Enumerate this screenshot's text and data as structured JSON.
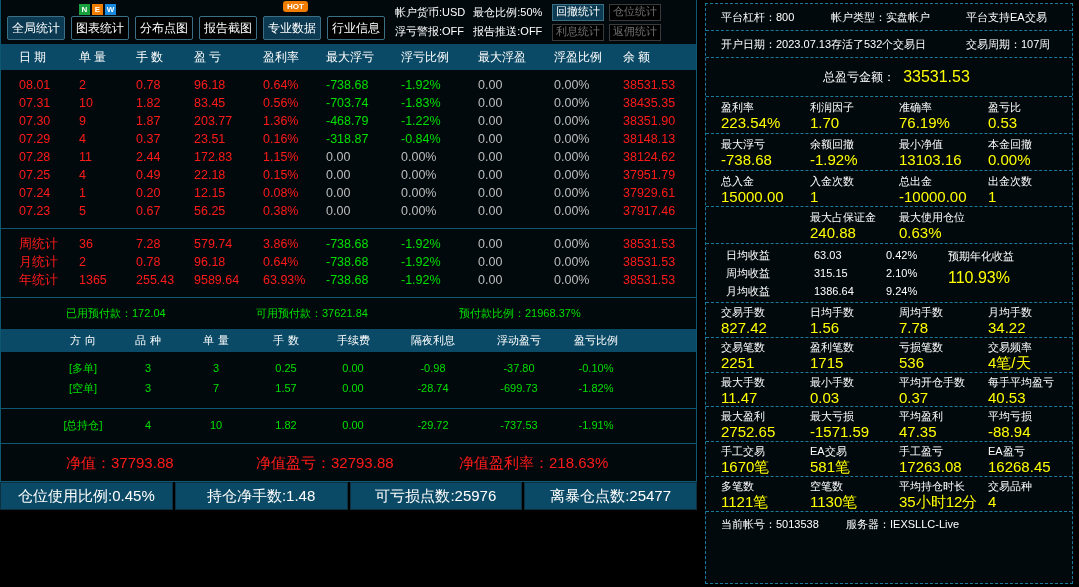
{
  "toolbar": {
    "buttons": [
      {
        "label": "全局统计",
        "selected": true
      },
      {
        "label": "图表统计",
        "selected": false,
        "badge": {
          "kind": "letters",
          "letters": [
            {
              "text": "N",
              "color": "#1aa03c"
            },
            {
              "text": "E",
              "color": "#f07d00"
            },
            {
              "text": "W",
              "color": "#1a8ae0"
            }
          ]
        }
      },
      {
        "label": "分布点图",
        "selected": false
      },
      {
        "label": "报告截图",
        "selected": false
      },
      {
        "label": "专业数据",
        "selected": true,
        "badge": {
          "kind": "tag",
          "text": "HOT"
        }
      },
      {
        "label": "行业信息",
        "selected": false
      }
    ],
    "info": [
      [
        "帐户货币:USD",
        "最仓比例:50%"
      ],
      [
        "浮亏警报:OFF",
        "报告推送:OFF"
      ]
    ],
    "side_buttons": [
      [
        {
          "label": "回撤统计",
          "disabled": false
        },
        {
          "label": "仓位统计",
          "disabled": true
        }
      ],
      [
        {
          "label": "利息统计",
          "disabled": true
        },
        {
          "label": "返佣统计",
          "disabled": true
        }
      ]
    ]
  },
  "daily_table": {
    "columns": [
      "日 期",
      "单 量",
      "手 数",
      "盈 亏",
      "盈利率",
      "最大浮亏",
      "浮亏比例",
      "最大浮盈",
      "浮盈比例",
      "余 额"
    ],
    "rows": [
      {
        "float_loss": true,
        "cells": [
          "08.01",
          "2",
          "0.78",
          "96.18",
          "0.64%",
          "-738.68",
          "-1.92%",
          "0.00",
          "0.00%",
          "38531.53"
        ]
      },
      {
        "float_loss": true,
        "cells": [
          "07.31",
          "10",
          "1.82",
          "83.45",
          "0.56%",
          "-703.74",
          "-1.83%",
          "0.00",
          "0.00%",
          "38435.35"
        ]
      },
      {
        "float_loss": true,
        "cells": [
          "07.30",
          "9",
          "1.87",
          "203.77",
          "1.36%",
          "-468.79",
          "-1.22%",
          "0.00",
          "0.00%",
          "38351.90"
        ]
      },
      {
        "float_loss": true,
        "cells": [
          "07.29",
          "4",
          "0.37",
          "23.51",
          "0.16%",
          "-318.87",
          "-0.84%",
          "0.00",
          "0.00%",
          "38148.13"
        ]
      },
      {
        "float_loss": false,
        "cells": [
          "07.28",
          "11",
          "2.44",
          "172.83",
          "1.15%",
          "0.00",
          "0.00%",
          "0.00",
          "0.00%",
          "38124.62"
        ]
      },
      {
        "float_loss": false,
        "cells": [
          "07.25",
          "4",
          "0.49",
          "22.18",
          "0.15%",
          "0.00",
          "0.00%",
          "0.00",
          "0.00%",
          "37951.79"
        ]
      },
      {
        "float_loss": false,
        "cells": [
          "07.24",
          "1",
          "0.20",
          "12.15",
          "0.08%",
          "0.00",
          "0.00%",
          "0.00",
          "0.00%",
          "37929.61"
        ]
      },
      {
        "float_loss": false,
        "cells": [
          "07.23",
          "5",
          "0.67",
          "56.25",
          "0.38%",
          "0.00",
          "0.00%",
          "0.00",
          "0.00%",
          "37917.46"
        ]
      }
    ],
    "summary": [
      {
        "float_loss": true,
        "cells": [
          "周统计",
          "36",
          "7.28",
          "579.74",
          "3.86%",
          "-738.68",
          "-1.92%",
          "0.00",
          "0.00%",
          "38531.53"
        ]
      },
      {
        "float_loss": true,
        "cells": [
          "月统计",
          "2",
          "0.78",
          "96.18",
          "0.64%",
          "-738.68",
          "-1.92%",
          "0.00",
          "0.00%",
          "38531.53"
        ]
      },
      {
        "float_loss": true,
        "cells": [
          "年统计",
          "1365",
          "255.43",
          "9589.64",
          "63.93%",
          "-738.68",
          "-1.92%",
          "0.00",
          "0.00%",
          "38531.53"
        ]
      }
    ]
  },
  "prepay": [
    "已用预付款：172.04",
    "可用预付款：37621.84",
    "预付款比例：21968.37%"
  ],
  "position_table": {
    "columns": [
      "方 向",
      "品 种",
      "单 量",
      "手 数",
      "手续费",
      "隔夜利息",
      "浮动盈亏",
      "盈亏比例"
    ],
    "rows": [
      [
        "[多单]",
        "3",
        "3",
        "0.25",
        "0.00",
        "-0.98",
        "-37.80",
        "-0.10%"
      ],
      [
        "[空单]",
        "3",
        "7",
        "1.57",
        "0.00",
        "-28.74",
        "-699.73",
        "-1.82%"
      ]
    ],
    "total": [
      "[总持仓]",
      "4",
      "10",
      "1.82",
      "0.00",
      "-29.72",
      "-737.53",
      "-1.91%"
    ]
  },
  "net": [
    "净值：37793.88",
    "净值盈亏：32793.88",
    "净值盈利率：218.63%"
  ],
  "status_bar": [
    "仓位使用比例:0.45%",
    "持仓净手数:1.48",
    "可亏损点数:25976",
    "离暴仓点数:25477"
  ],
  "account": {
    "rows": [
      [
        "平台杠杆：800",
        "帐户类型：实盘帐户",
        "平台支持EA交易"
      ],
      [
        "开户日期：2023.07.13",
        "存活了532个交易日",
        "交易周期：107周"
      ]
    ],
    "total": {
      "label": "总盈亏金额：",
      "value": "33531.53"
    },
    "groups": [
      {
        "kind": "grid",
        "items": [
          {
            "label": "盈利率",
            "value": "223.54%"
          },
          {
            "label": "利润因子",
            "value": "1.70"
          },
          {
            "label": "准确率",
            "value": "76.19%"
          },
          {
            "label": "盈亏比",
            "value": "0.53"
          }
        ]
      },
      {
        "kind": "grid",
        "items": [
          {
            "label": "最大浮亏",
            "value": "-738.68"
          },
          {
            "label": "余额回撤",
            "value": "-1.92%"
          },
          {
            "label": "最小净值",
            "value": "13103.16"
          },
          {
            "label": "本金回撤",
            "value": "0.00%"
          }
        ]
      },
      {
        "kind": "grid",
        "items": [
          {
            "label": "总入金",
            "value": "15000.00"
          },
          {
            "label": "入金次数",
            "value": "1"
          },
          {
            "label": "总出金",
            "value": "-10000.00"
          },
          {
            "label": "出金次数",
            "value": "1"
          }
        ]
      },
      {
        "kind": "centered",
        "items": [
          {
            "label": "最大占保证金",
            "value": "240.88"
          },
          {
            "label": "最大使用仓位",
            "value": "0.63%"
          }
        ]
      }
    ],
    "income": {
      "rows": [
        [
          "日均收益",
          "63.03",
          "0.42%"
        ],
        [
          "周均收益",
          "315.15",
          "2.10%"
        ],
        [
          "月均收益",
          "1386.64",
          "9.24%"
        ]
      ],
      "annual": {
        "label": "预期年化收益",
        "value": "110.93%"
      }
    },
    "groups2": [
      {
        "kind": "grid",
        "items": [
          {
            "label": "交易手数",
            "value": "827.42"
          },
          {
            "label": "日均手数",
            "value": "1.56"
          },
          {
            "label": "周均手数",
            "value": "7.78"
          },
          {
            "label": "月均手数",
            "value": "34.22"
          }
        ]
      },
      {
        "kind": "grid",
        "items": [
          {
            "label": "交易笔数",
            "value": "2251"
          },
          {
            "label": "盈利笔数",
            "value": "1715"
          },
          {
            "label": "亏损笔数",
            "value": "536"
          },
          {
            "label": "交易频率",
            "value": "4笔/天"
          }
        ]
      },
      {
        "kind": "grid",
        "items": [
          {
            "label": "最大手数",
            "value": "11.47"
          },
          {
            "label": "最小手数",
            "value": "0.03"
          },
          {
            "label": "平均开仓手数",
            "value": "0.37"
          },
          {
            "label": "每手平均盈亏",
            "value": "40.53"
          }
        ]
      },
      {
        "kind": "grid",
        "items": [
          {
            "label": "最大盈利",
            "value": "2752.65"
          },
          {
            "label": "最大亏损",
            "value": "-1571.59"
          },
          {
            "label": "平均盈利",
            "value": "47.35"
          },
          {
            "label": "平均亏损",
            "value": "-88.94"
          }
        ]
      },
      {
        "kind": "grid",
        "items": [
          {
            "label": "手工交易",
            "value": "1670笔"
          },
          {
            "label": "EA交易",
            "value": "581笔"
          },
          {
            "label": "手工盈亏",
            "value": "17263.08"
          },
          {
            "label": "EA盈亏",
            "value": "16268.45"
          }
        ]
      },
      {
        "kind": "grid",
        "items": [
          {
            "label": "多笔数",
            "value": "1121笔"
          },
          {
            "label": "空笔数",
            "value": "1130笔"
          },
          {
            "label": "平均持仓时长",
            "value": "35小时12分"
          },
          {
            "label": "交易品种",
            "value": "4"
          }
        ]
      }
    ],
    "footer": [
      "当前帐号：5013538",
      "服务器：IEXSLLC-Live"
    ]
  }
}
